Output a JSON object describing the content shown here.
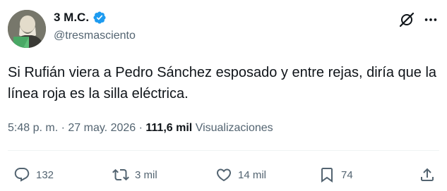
{
  "author": {
    "display_name": "3 M.C.",
    "handle": "@tresmasciento",
    "verified": true
  },
  "tweet": {
    "text": "Si Rufián viera a Pedro Sánchez esposado y entre rejas, diría que la línea roja es la silla eléctrica."
  },
  "meta": {
    "time": "5:48 p. m.",
    "date": "27 may. 2026",
    "separator": "·",
    "views_count": "111,6 mil",
    "views_label": "Visualizaciones"
  },
  "actions": {
    "replies": "132",
    "reposts": "3 mil",
    "likes": "14 mil",
    "bookmarks": "74"
  },
  "colors": {
    "verified_badge": "#1d9bf0",
    "secondary_text": "#536471",
    "primary_text": "#0f1419",
    "divider": "#eff3f4"
  },
  "icons": [
    "verified-badge-icon",
    "grok-icon",
    "more-options-icon",
    "reply-icon",
    "repost-icon",
    "like-icon",
    "bookmark-icon",
    "share-icon"
  ]
}
